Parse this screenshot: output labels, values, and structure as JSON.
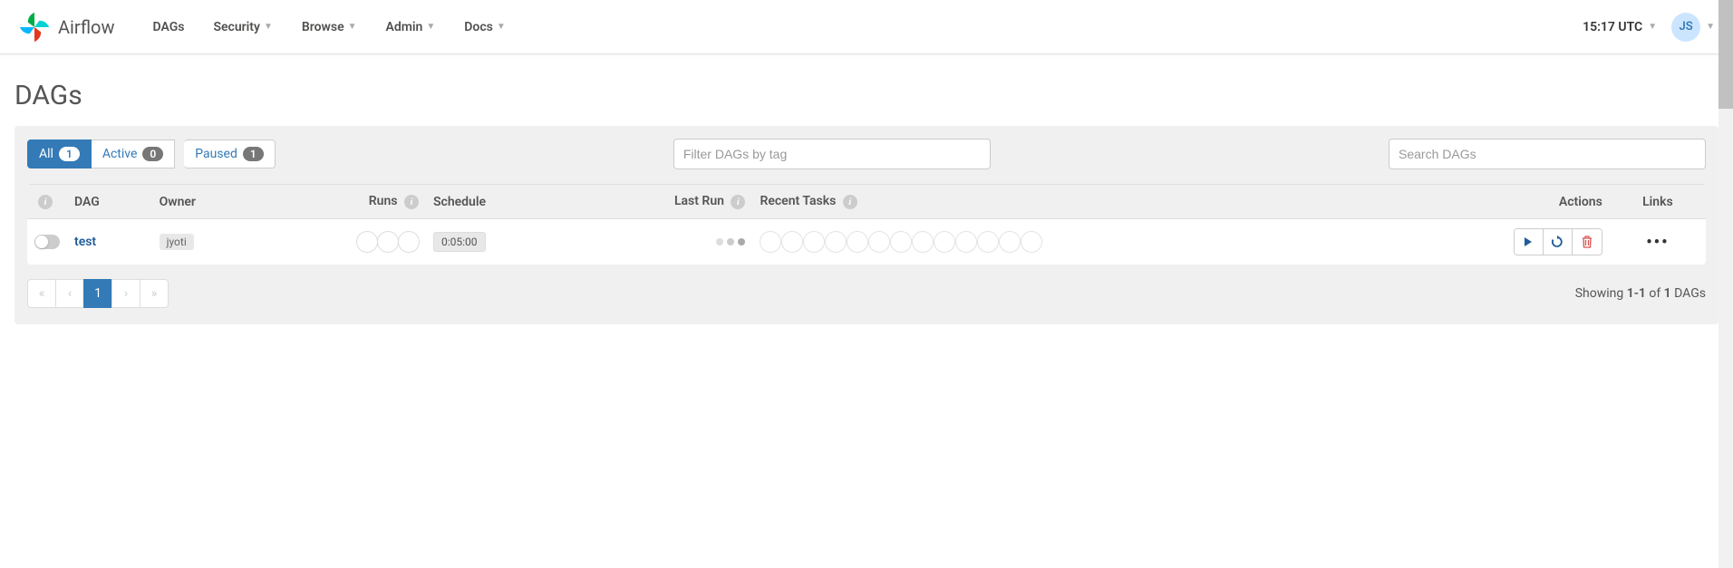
{
  "brand": "Airflow",
  "nav": {
    "items": [
      "DAGs",
      "Security",
      "Browse",
      "Admin",
      "Docs"
    ],
    "has_dropdown": [
      false,
      true,
      true,
      true,
      true
    ]
  },
  "time": "15:17 UTC",
  "user_initials": "JS",
  "page_title": "DAGs",
  "filters": {
    "all": {
      "label": "All",
      "count": "1"
    },
    "active": {
      "label": "Active",
      "count": "0"
    },
    "paused": {
      "label": "Paused",
      "count": "1"
    }
  },
  "filter_tag_placeholder": "Filter DAGs by tag",
  "search_placeholder": "Search DAGs",
  "columns": {
    "dag": "DAG",
    "owner": "Owner",
    "runs": "Runs",
    "schedule": "Schedule",
    "last_run": "Last Run",
    "recent_tasks": "Recent Tasks",
    "actions": "Actions",
    "links": "Links"
  },
  "rows": [
    {
      "name": "test",
      "owner": "jyoti",
      "schedule": "0:05:00"
    }
  ],
  "pagination": {
    "current": "1",
    "showing_prefix": "Showing ",
    "range": "1-1",
    "of": " of ",
    "total": "1",
    "suffix": " DAGs"
  }
}
